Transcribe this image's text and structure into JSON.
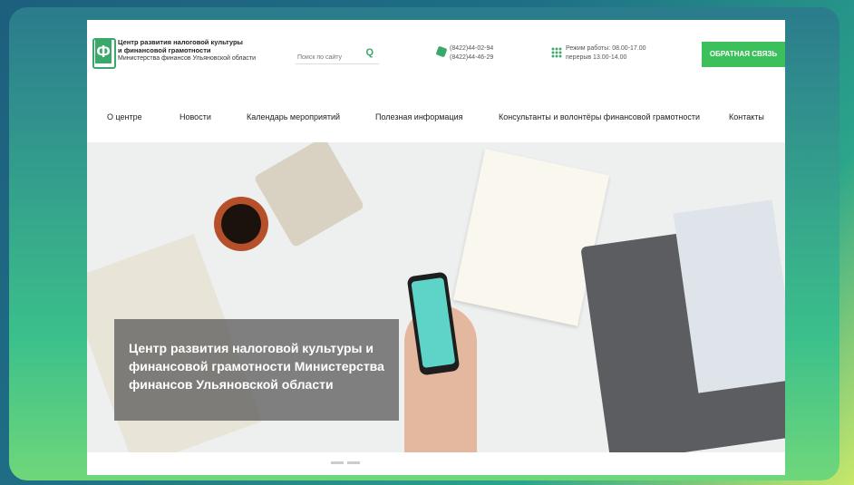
{
  "header": {
    "org_line1": "Центр развития налоговой культуры",
    "org_line2": "и финансовой грамотности",
    "org_line3": "Министерства финансов Ульяновской области",
    "search_placeholder": "Поиск по сайту",
    "search_icon": "Q",
    "phone1": "(8422)44-02-94",
    "phone2": "(8422)44-46-29",
    "hours1": "Режим работы: 08.00-17.00",
    "hours2": "перерыв 13.00-14.00",
    "feedback_label": "ОБРАТНАЯ СВЯЗЬ"
  },
  "nav": {
    "items": [
      {
        "label": "О центре"
      },
      {
        "label": "Новости"
      },
      {
        "label": "Календарь мероприятий"
      },
      {
        "label": "Полезная информация"
      },
      {
        "label": "Консультанты и волонтёры финансовой грамотности"
      },
      {
        "label": "Контакты"
      }
    ]
  },
  "hero": {
    "caption": "Центр развития налоговой культуры и финансовой грамотности Министерства финансов Ульяновской области"
  },
  "colors": {
    "accent": "#3cc05b",
    "logo_green": "#3aa86b"
  }
}
